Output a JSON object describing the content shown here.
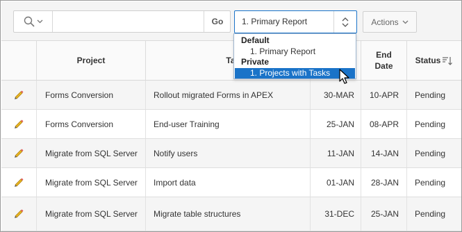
{
  "toolbar": {
    "search_placeholder": "",
    "go_label": "Go",
    "report_selected": "1. Primary Report",
    "actions_label": "Actions"
  },
  "report_menu": {
    "groups": [
      {
        "label": "Default",
        "items": [
          {
            "label": "1. Primary Report"
          }
        ]
      },
      {
        "label": "Private",
        "items": [
          {
            "label": "1. Projects with Tasks",
            "highlighted": true
          }
        ]
      }
    ]
  },
  "table": {
    "headers": {
      "project": "Project",
      "task": "Task Na",
      "start": "",
      "end_line1": "End",
      "end_line2": "Date",
      "status": "Status"
    },
    "rows": [
      {
        "project": "Forms Conversion",
        "task": "Rollout migrated Forms in APEX",
        "start": "30-MAR",
        "end": "10-APR",
        "status": "Pending"
      },
      {
        "project": "Forms Conversion",
        "task": "End-user Training",
        "start": "25-JAN",
        "end": "08-APR",
        "status": "Pending"
      },
      {
        "project": "Migrate from SQL Server",
        "task": "Notify users",
        "start": "11-JAN",
        "end": "14-JAN",
        "status": "Pending"
      },
      {
        "project": "Migrate from SQL Server",
        "task": "Import data",
        "start": "01-JAN",
        "end": "28-JAN",
        "status": "Pending"
      },
      {
        "project": "Migrate from SQL Server",
        "task": "Migrate table structures",
        "start": "31-DEC",
        "end": "25-JAN",
        "status": "Pending"
      }
    ]
  },
  "icons": {
    "search": "search-icon",
    "edit": "pencil-icon",
    "sort": "sort-descending-icon",
    "select_arrows": "up-down-arrows-icon",
    "chevron": "chevron-down-icon",
    "cursor": "mouse-pointer-icon"
  },
  "colors": {
    "accent": "#1a73c8",
    "pencil": "#e8b923"
  }
}
